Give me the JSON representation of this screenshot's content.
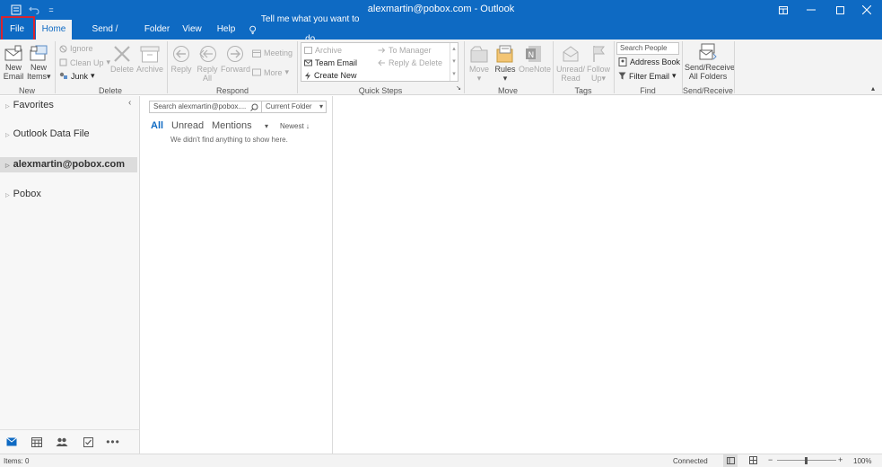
{
  "titlebar": {
    "title": "alexmartin@pobox.com  -  Outlook",
    "icons": [
      "app-icon",
      "undo-icon",
      "customize-icon",
      "ribbon-display-icon",
      "minimize-icon",
      "maximize-icon",
      "close-icon"
    ]
  },
  "tabs": [
    "File",
    "Home",
    "Send / Receive",
    "Folder",
    "View",
    "Help"
  ],
  "tell_me": "Tell me what you want to do",
  "ribbon": {
    "new": {
      "new_email": "New\nEmail",
      "new_email_1": "New",
      "new_email_2": "Email",
      "new_items_1": "New",
      "new_items_2": "Items",
      "group": "New"
    },
    "delete": {
      "ignore": "Ignore",
      "clean_up": "Clean Up",
      "junk": "Junk",
      "delete": "Delete",
      "archive": "Archive",
      "group": "Delete"
    },
    "respond": {
      "reply": "Reply",
      "reply_all_1": "Reply",
      "reply_all_2": "All",
      "forward": "Forward",
      "meeting": "Meeting",
      "more": "More",
      "group": "Respond"
    },
    "quick_steps": {
      "archive": "Archive",
      "to_manager": "To Manager",
      "team_email": "Team Email",
      "reply_delete": "Reply & Delete",
      "create_new": "Create New",
      "group": "Quick Steps"
    },
    "move": {
      "move": "Move",
      "rules": "Rules",
      "onenote": "OneNote",
      "group": "Move"
    },
    "tags": {
      "unread_read_1": "Unread/",
      "unread_read_2": "Read",
      "follow_up_1": "Follow",
      "follow_up_2": "Up",
      "group": "Tags"
    },
    "find": {
      "search_people": "Search People",
      "address_book": "Address Book",
      "filter_email": "Filter Email",
      "group": "Find"
    },
    "send_receive": {
      "label_1": "Send/Receive",
      "label_2": "All Folders",
      "group": "Send/Receive"
    }
  },
  "nav": {
    "folders": [
      "Favorites",
      "Outlook Data File",
      "alexmartin@pobox.com",
      "Pobox"
    ]
  },
  "message_list": {
    "search_placeholder": "Search alexmartin@pobox....",
    "scope": "Current Folder",
    "filters": [
      "All",
      "Unread",
      "Mentions"
    ],
    "sort": "Newest",
    "empty": "We didn't find anything to show here."
  },
  "status": {
    "items": "Items: 0",
    "connection": "Connected",
    "zoom": "100%"
  },
  "colors": {
    "accent": "#0e6ac3",
    "highlight": "#d9242f"
  }
}
